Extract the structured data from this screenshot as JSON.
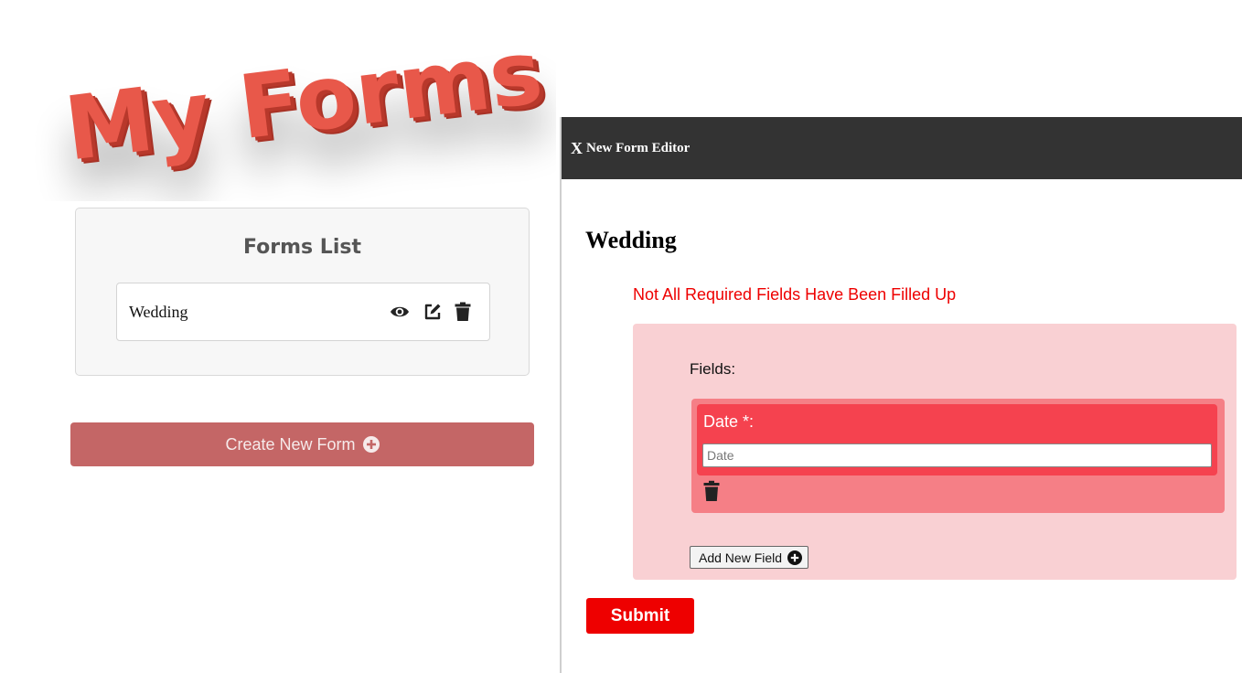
{
  "app": {
    "logo_text": "My Forms"
  },
  "forms_list": {
    "title": "Forms List",
    "items": [
      {
        "name": "Wedding",
        "actions": [
          "eye-icon",
          "edit-icon",
          "trash-icon"
        ]
      }
    ]
  },
  "create_button": {
    "label": "Create New Form",
    "icon": "plus-circle-icon"
  },
  "editor": {
    "close_label": "X",
    "title": "New Form Editor",
    "form_name": "Wedding",
    "error_message": "Not All Required Fields Have Been Filled Up",
    "fields_label": "Fields:",
    "fields": [
      {
        "label": "Date *:",
        "placeholder": "Date",
        "value": ""
      }
    ],
    "add_field_label": "Add New Field",
    "submit_label": "Submit"
  },
  "colors": {
    "logo": "#e8584a",
    "header_bg": "#333333",
    "error": "#ee0000",
    "fields_bg": "#f9d0d3",
    "field_card": "#f57f86",
    "field_inner": "#f5424f",
    "create_button": "#c46666"
  }
}
